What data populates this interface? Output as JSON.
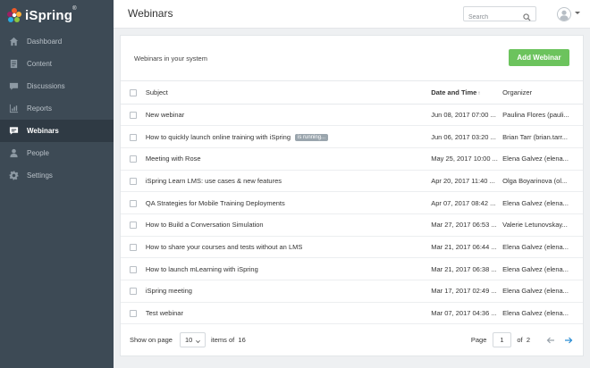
{
  "app": {
    "logo_text": "iSpring",
    "logo_mark": "®",
    "accent": "#6cc35d"
  },
  "sidebar": {
    "items": [
      {
        "label": "Dashboard",
        "icon": "home-icon",
        "active": false
      },
      {
        "label": "Content",
        "icon": "content-icon",
        "active": false
      },
      {
        "label": "Discussions",
        "icon": "discussions-icon",
        "active": false
      },
      {
        "label": "Reports",
        "icon": "reports-icon",
        "active": false
      },
      {
        "label": "Webinars",
        "icon": "webinars-icon",
        "active": true
      },
      {
        "label": "People",
        "icon": "people-icon",
        "active": false
      },
      {
        "label": "Settings",
        "icon": "gear-icon",
        "active": false
      }
    ]
  },
  "header": {
    "title": "Webinars",
    "search_placeholder": "Search"
  },
  "panel": {
    "subtitle": "Webinars in your system",
    "add_button": "Add Webinar",
    "columns": {
      "subject": "Subject",
      "date": "Date and Time",
      "organizer": "Organizer"
    },
    "rows": [
      {
        "subject": "New webinar",
        "badge": "",
        "date": "Jun 08, 2017 07:00 ...",
        "organizer": "Paulina Flores (pauli..."
      },
      {
        "subject": "How to quickly launch online training with iSpring",
        "badge": "is running...",
        "date": "Jun 06, 2017 03:20 ...",
        "organizer": "Brian Tarr (brian.tarr..."
      },
      {
        "subject": "Meeting with Rose",
        "badge": "",
        "date": "May 25, 2017 10:00 ...",
        "organizer": "Elena Galvez (elena..."
      },
      {
        "subject": "iSpring Learn LMS: use cases & new features",
        "badge": "",
        "date": "Apr 20, 2017 11:40 ...",
        "organizer": "Olga Boyarinova (ol..."
      },
      {
        "subject": "QA Strategies for Mobile Training Deployments",
        "badge": "",
        "date": "Apr 07, 2017 08:42 ...",
        "organizer": "Elena Galvez (elena..."
      },
      {
        "subject": "How to Build a Conversation Simulation",
        "badge": "",
        "date": "Mar 27, 2017 06:53 ...",
        "organizer": "Valerie Letunovskay..."
      },
      {
        "subject": "How to share your courses and tests without an LMS",
        "badge": "",
        "date": "Mar 21, 2017 06:44 ...",
        "organizer": "Elena Galvez (elena..."
      },
      {
        "subject": "How to launch mLearning with iSpring",
        "badge": "",
        "date": "Mar 21, 2017 06:38 ...",
        "organizer": "Elena Galvez (elena..."
      },
      {
        "subject": "iSpring meeting",
        "badge": "",
        "date": "Mar 17, 2017 02:49 ...",
        "organizer": "Elena Galvez (elena..."
      },
      {
        "subject": "Test webinar",
        "badge": "",
        "date": "Mar 07, 2017 04:36 ...",
        "organizer": "Elena Galvez (elena..."
      }
    ],
    "footer": {
      "show_on_page": "Show on page",
      "per_page": "10",
      "items_of": "items of",
      "total_items": "16",
      "page_label": "Page",
      "page_value": "1",
      "of_label": "of",
      "total_pages": "2"
    }
  }
}
